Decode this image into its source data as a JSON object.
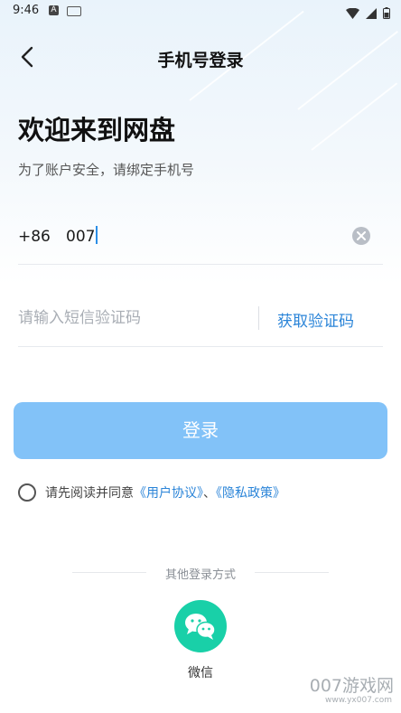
{
  "status_bar": {
    "time": "9:46",
    "left_icons": [
      "a-notification-icon",
      "keyboard-icon"
    ],
    "right_icons": [
      "wifi-icon",
      "signal-icon",
      "battery-icon"
    ]
  },
  "header": {
    "back_icon": "chevron-left-icon",
    "title": "手机号登录"
  },
  "welcome": {
    "title": "欢迎来到网盘",
    "subtitle": "为了账户安全，请绑定手机号"
  },
  "phone": {
    "country_code": "+86",
    "value": "007",
    "clear_icon": "clear-icon"
  },
  "code": {
    "placeholder": "请输入短信验证码",
    "value": "",
    "get_code_label": "获取验证码"
  },
  "login": {
    "button_label": "登录",
    "state": "disabled"
  },
  "agreement": {
    "prefix": "请先阅读并同意",
    "user_agreement": "《用户协议》",
    "separator": "、",
    "privacy_policy": "《隐私政策》",
    "checked": false
  },
  "other_login": {
    "title": "其他登录方式",
    "wechat_label": "微信",
    "wechat_icon": "wechat-icon"
  },
  "watermark": {
    "text": "007游戏网",
    "url": "www.yx007.com"
  },
  "colors": {
    "accent": "#2a84d8",
    "login_button": "#82c2f8",
    "wechat": "#19d0a8"
  }
}
